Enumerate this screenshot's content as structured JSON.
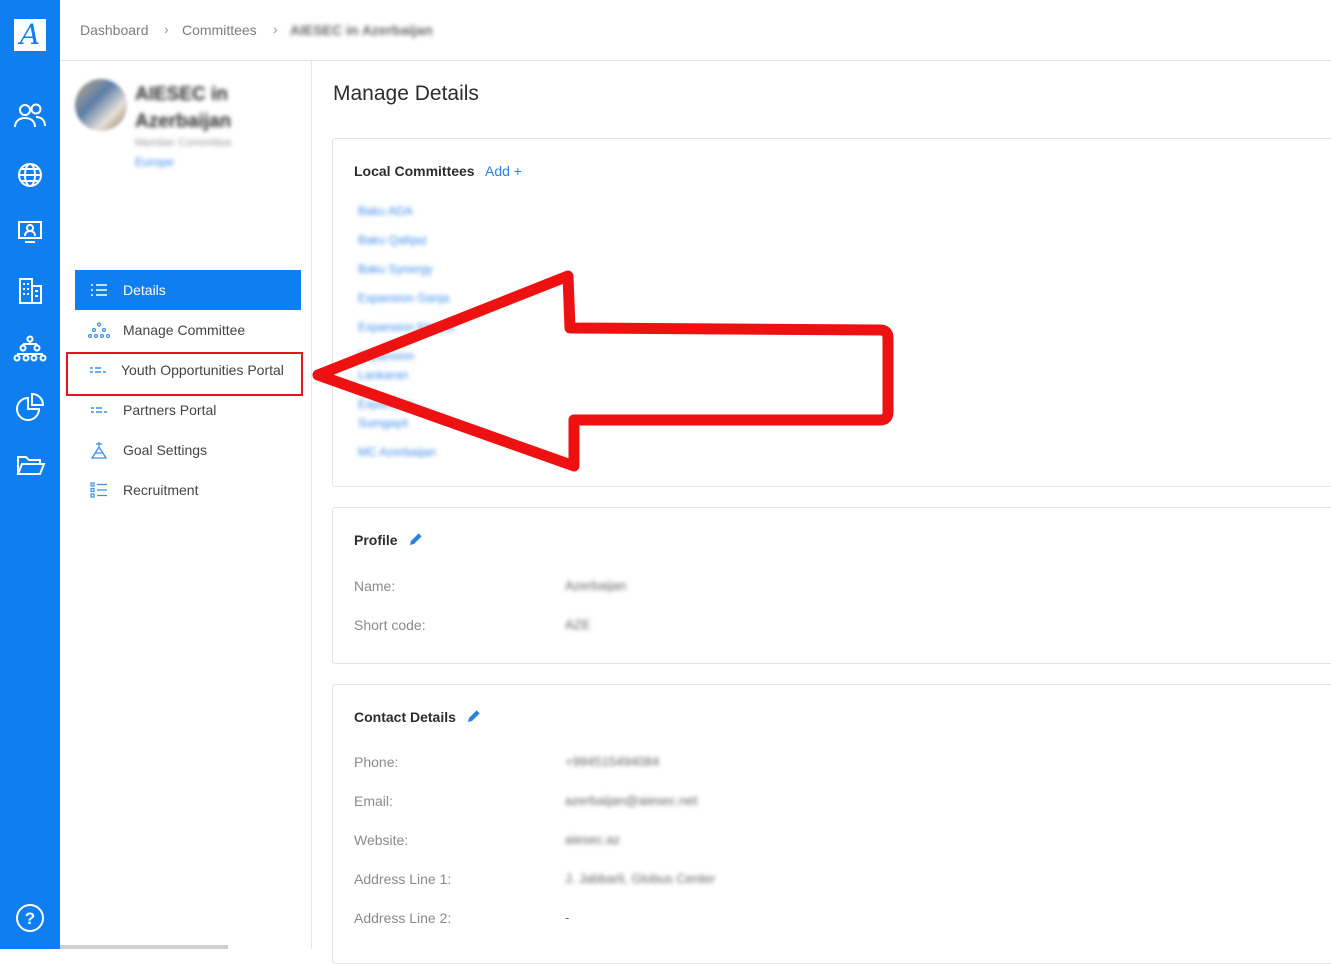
{
  "app": {
    "logo_letter": "A"
  },
  "rail": {
    "items": [
      {
        "icon": "people-icon"
      },
      {
        "icon": "globe-icon"
      },
      {
        "icon": "monitor-person-icon"
      },
      {
        "icon": "building-icon"
      },
      {
        "icon": "org-chart-icon"
      },
      {
        "icon": "pie-chart-icon"
      },
      {
        "icon": "folder-open-icon"
      }
    ],
    "help_label": "?"
  },
  "breadcrumb": {
    "items": [
      "Dashboard",
      "Committees",
      "AIESEC in Azerbaijan"
    ],
    "separator": ">"
  },
  "committee": {
    "name": "AIESEC in Azerbaijan",
    "type": "Member Committee",
    "region": "Europe"
  },
  "menu": {
    "items": [
      {
        "label": "Details",
        "icon": "details-list-icon",
        "active": true
      },
      {
        "label": "Manage Committee",
        "icon": "manage-committee-icon",
        "active": false
      },
      {
        "label": "Youth Opportunities Portal",
        "icon": "yop-icon",
        "active": false
      },
      {
        "label": "Partners Portal",
        "icon": "partners-portal-icon",
        "active": false
      },
      {
        "label": "Goal Settings",
        "icon": "goal-settings-icon",
        "active": false
      },
      {
        "label": "Recruitment",
        "icon": "recruitment-icon",
        "active": false
      }
    ]
  },
  "main": {
    "title": "Manage Details",
    "local_committees": {
      "heading": "Local Committees",
      "add_label": "Add +",
      "items": [
        "Baku ADA",
        "Baku Qafqaz",
        "Baku Synergy",
        "Expansion Ganja",
        "Expansion Khazar",
        "Expansion",
        "Lankaran",
        "Expansion",
        "Sumgayit",
        "MC Azerbaijan"
      ]
    },
    "profile": {
      "heading": "Profile",
      "fields": [
        {
          "label": "Name:",
          "value": "Azerbaijan"
        },
        {
          "label": "Short code:",
          "value": "AZE"
        }
      ]
    },
    "contact": {
      "heading": "Contact Details",
      "fields": [
        {
          "label": "Phone:",
          "value": "+994515494084"
        },
        {
          "label": "Email:",
          "value": "azerbaijan@aiesec.net"
        },
        {
          "label": "Website:",
          "value": "aiesec.az"
        },
        {
          "label": "Address Line 1:",
          "value": "J. Jabbarli, Globus Center"
        },
        {
          "label": "Address Line 2:",
          "value": "-"
        }
      ]
    }
  },
  "colors": {
    "brand": "#0f7ef0",
    "highlight": "#e6141e",
    "link": "#2d7fe0"
  }
}
